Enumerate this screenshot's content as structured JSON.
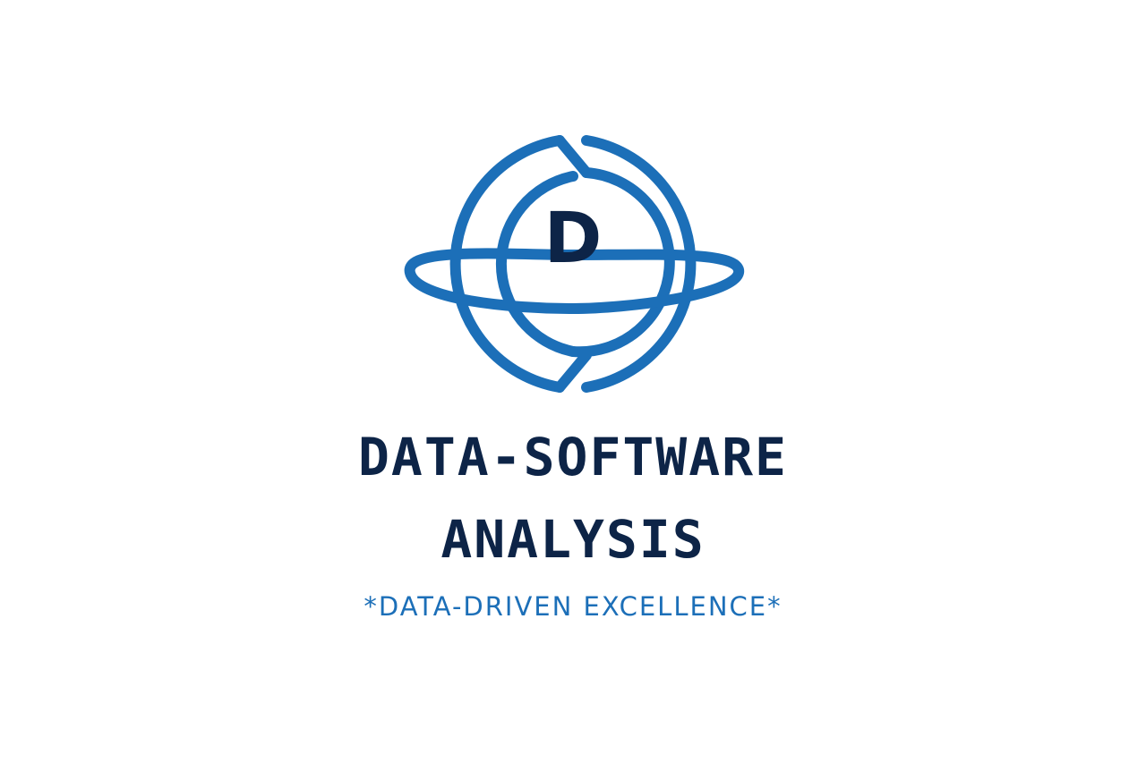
{
  "logo": {
    "monogram": "D",
    "brand_line_1": "DATA-SOFTWARE",
    "brand_line_2": "ANALYSIS",
    "tagline": "*DATA-DRIVEN EXCELLENCE*",
    "emblem_icon": "globe-orbit-icon"
  },
  "colors": {
    "primary_blue": "#1c6fb8",
    "navy_text": "#0d2447",
    "background": "#ffffff"
  }
}
